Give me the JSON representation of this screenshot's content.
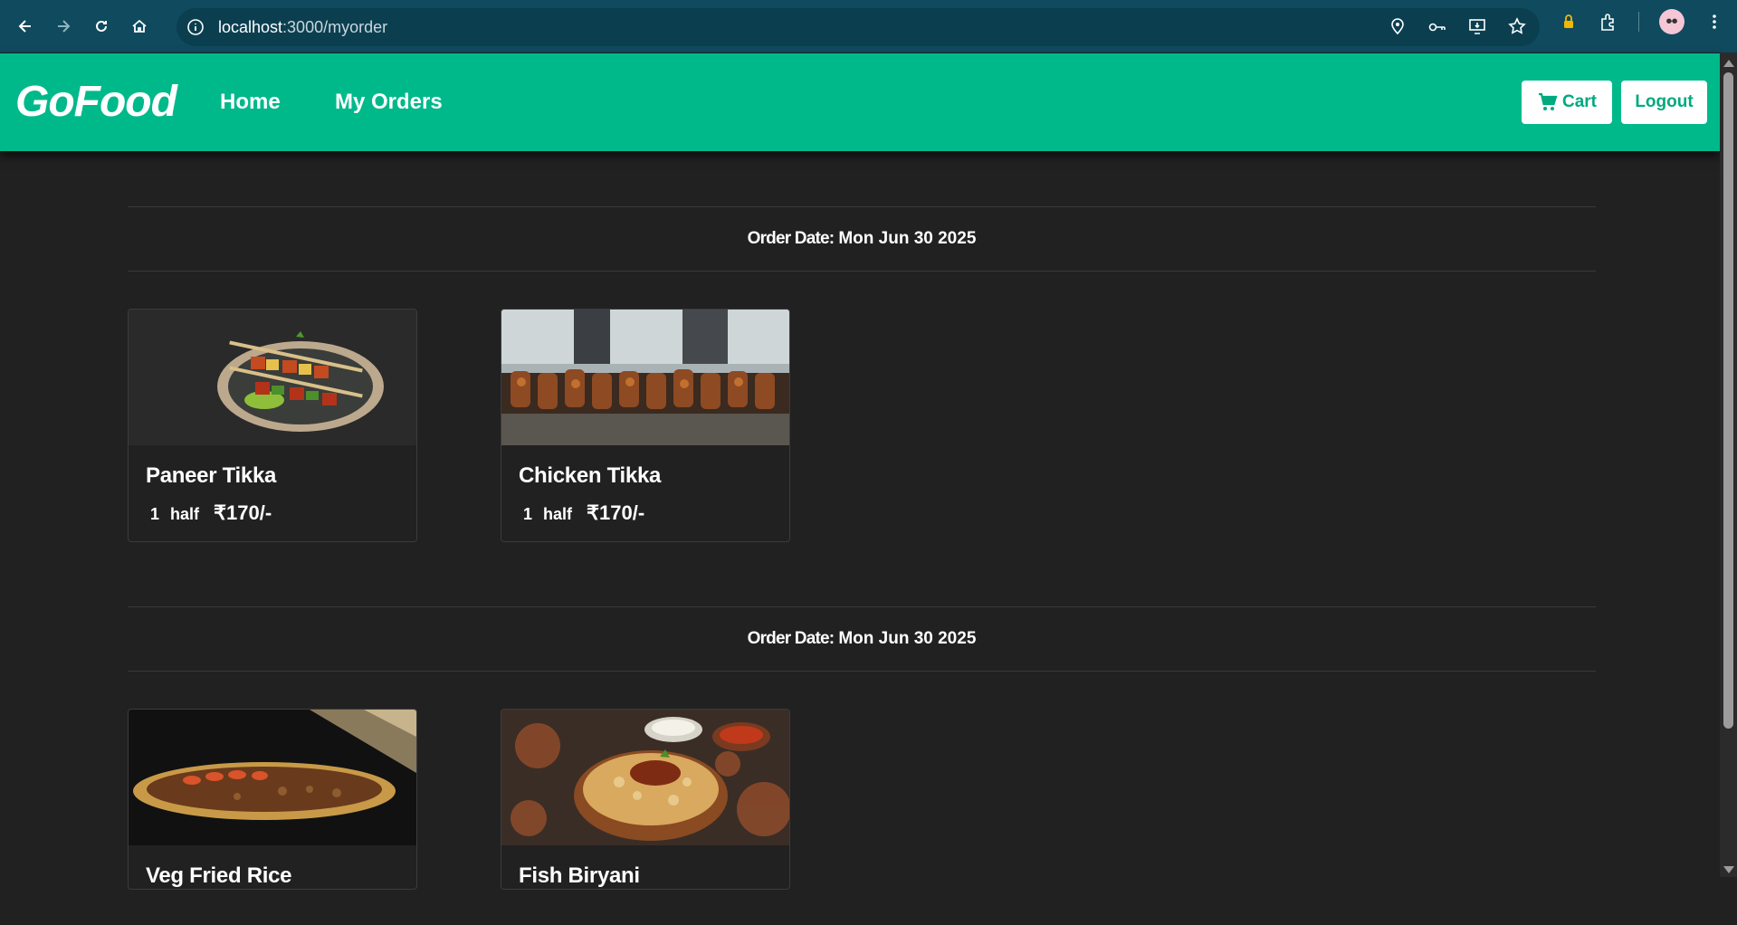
{
  "browser": {
    "url_host": "localhost",
    "url_path": ":3000/myorder"
  },
  "navbar": {
    "brand": "GoFood",
    "links": [
      "Home",
      "My Orders"
    ],
    "cart_label": "Cart",
    "logout_label": "Logout"
  },
  "orders": [
    {
      "date_label": "Order Date:",
      "date_value": "Mon Jun 30 2025",
      "items": [
        {
          "name": "Paneer Tikka",
          "qty": "1",
          "size": "half",
          "price": "₹170/-"
        },
        {
          "name": "Chicken Tikka",
          "qty": "1",
          "size": "half",
          "price": "₹170/-"
        }
      ]
    },
    {
      "date_label": "Order Date:",
      "date_value": "Mon Jun 30 2025",
      "items": [
        {
          "name": "Veg Fried Rice"
        },
        {
          "name": "Fish Biryani"
        }
      ]
    }
  ],
  "colors": {
    "navbar_bg": "#00b98b",
    "page_bg": "#212121",
    "browser_bg": "#0f4a5e"
  }
}
